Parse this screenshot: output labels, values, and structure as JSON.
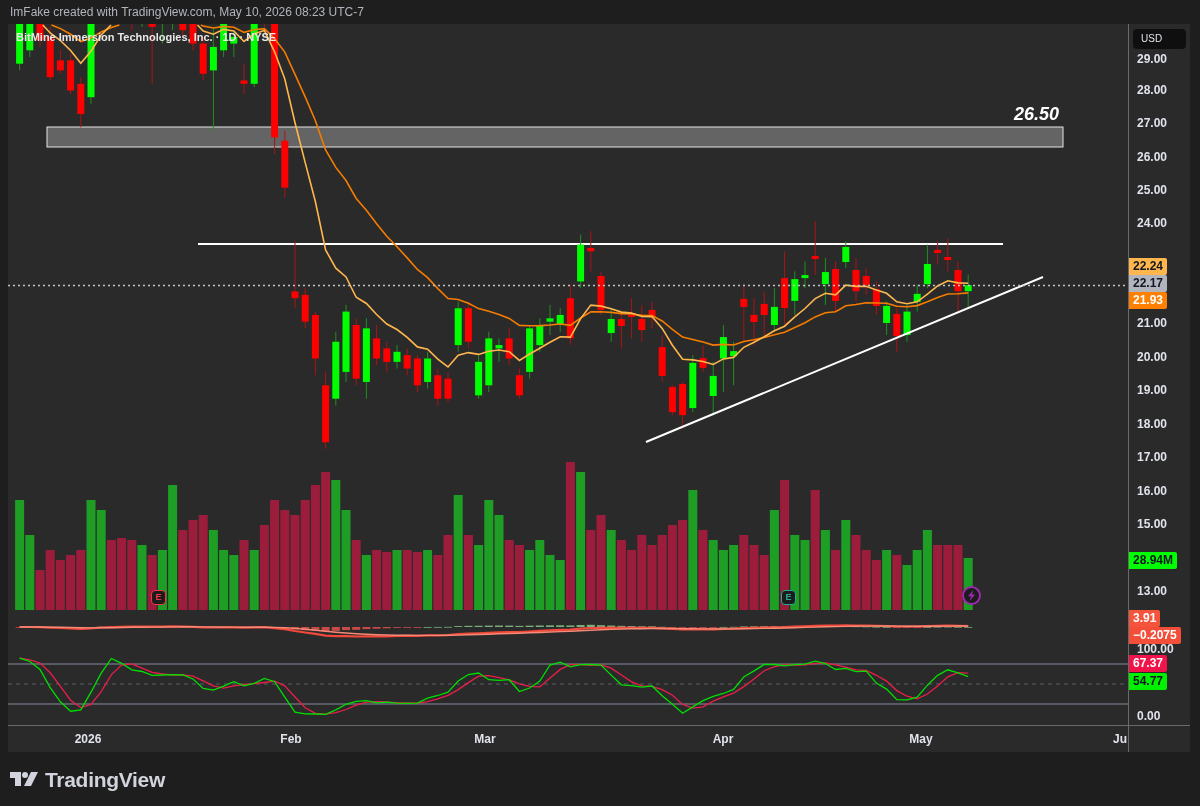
{
  "snapshot_caption": "ImFake created with TradingView.com, May 10, 2026 08:23 UTC-7",
  "chart": {
    "symbol_title": "BitMine Immersion Technologies, Inc. · 1D · NYSE",
    "zone_label": "26.50",
    "events": [
      {
        "kind": "earnings",
        "label": "E",
        "color": "#f23645"
      },
      {
        "kind": "earnings",
        "label": "E",
        "color": "#22ab94"
      },
      {
        "kind": "flash",
        "color": "#9c27b0"
      }
    ]
  },
  "price_axis": {
    "currency_button": "USD",
    "labels": [
      "29.00",
      "28.00",
      "27.00",
      "26.00",
      "25.00",
      "24.00",
      "21.00",
      "20.00",
      "19.00",
      "18.00",
      "17.00",
      "16.00",
      "15.00",
      "13.00"
    ],
    "oscillator_labels": [
      "100.00",
      "0.00"
    ],
    "value_tags": [
      {
        "text": "22.24",
        "kind": "ma-fast",
        "color": "#ffb74d"
      },
      {
        "text": "22.17",
        "kind": "last-price",
        "color": "#b2b5be"
      },
      {
        "text": "21.93",
        "kind": "ma-slow",
        "color": "#ff8000"
      },
      {
        "text": "28.94M",
        "kind": "volume",
        "color": "#00ff00"
      },
      {
        "text": "3.91",
        "kind": "macd",
        "color": "#f4543c"
      },
      {
        "text": "−0.2075",
        "kind": "macd-histogram",
        "color": "#f24e3a"
      },
      {
        "text": "67.37",
        "kind": "stoch-d",
        "color": "#f0144a"
      },
      {
        "text": "54.77",
        "kind": "stoch-k",
        "color": "#00f000"
      }
    ]
  },
  "time_axis": {
    "labels": [
      "2026",
      "Feb",
      "Mar",
      "Apr",
      "May",
      "Ju"
    ]
  },
  "footer": {
    "brand": "TradingView"
  }
}
